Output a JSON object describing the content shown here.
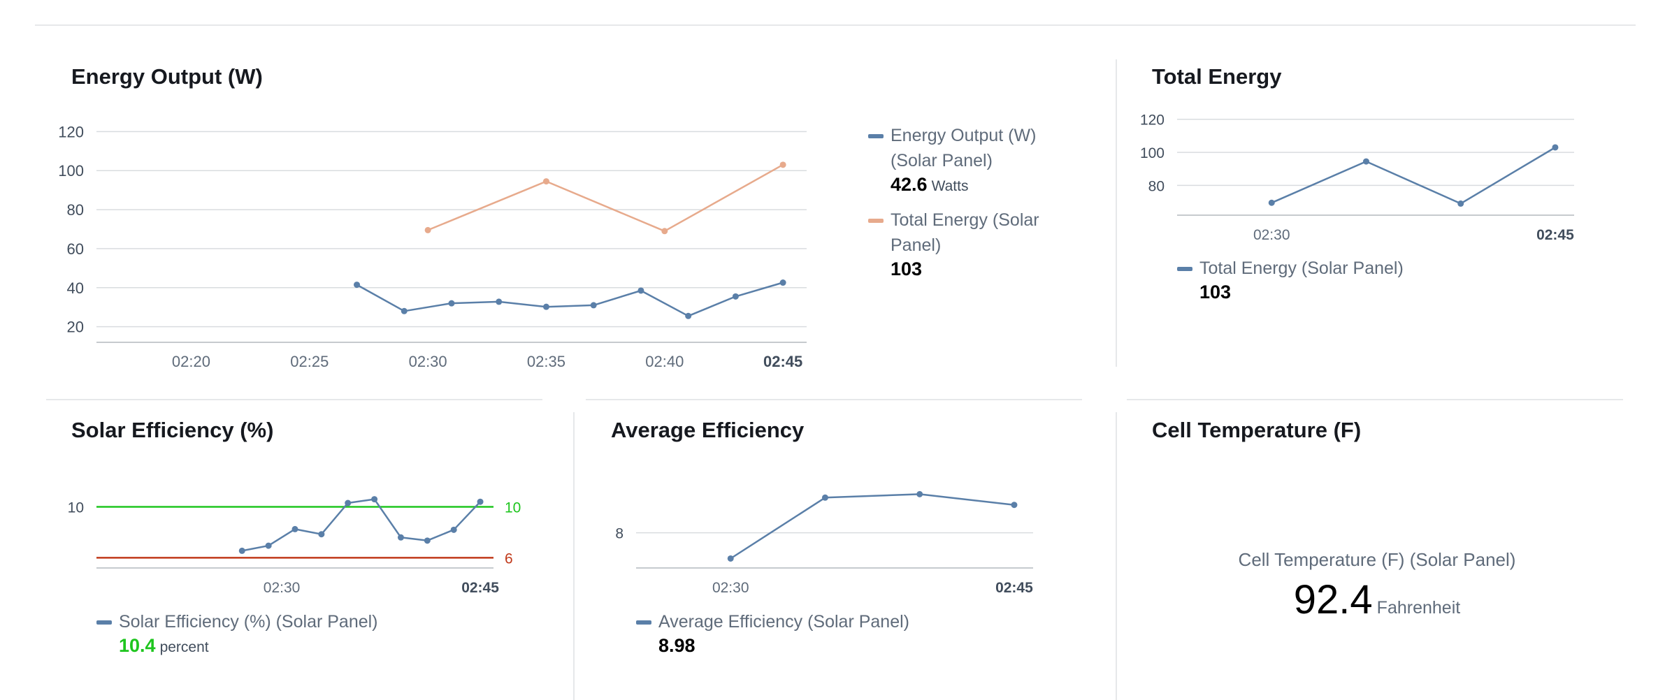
{
  "panels": {
    "energy_output": {
      "title": "Energy Output (W)",
      "legend": [
        {
          "name": "Energy Output (W) (Solar Panel)",
          "value": "42.6",
          "unit": "Watts",
          "color": "#5a7fa8"
        },
        {
          "name": "Total Energy (Solar Panel)",
          "value": "103",
          "unit": "",
          "color": "#e7aa8c"
        }
      ]
    },
    "total_energy": {
      "title": "Total Energy",
      "legend": [
        {
          "name": "Total Energy (Solar Panel)",
          "value": "103",
          "unit": "",
          "color": "#5a7fa8"
        }
      ]
    },
    "solar_efficiency": {
      "title": "Solar Efficiency (%)",
      "legend": [
        {
          "name": "Solar Efficiency (%) (Solar Panel)",
          "value": "10.4",
          "unit": "percent",
          "color": "#5a7fa8",
          "value_color": "#1ec51e"
        }
      ]
    },
    "average_efficiency": {
      "title": "Average Efficiency",
      "legend": [
        {
          "name": "Average Efficiency (Solar Panel)",
          "value": "8.98",
          "unit": "",
          "color": "#5a7fa8"
        }
      ]
    },
    "cell_temperature": {
      "title": "Cell Temperature (F)",
      "kpi_name": "Cell Temperature (F) (Solar Panel)",
      "kpi_value": "92.4",
      "kpi_unit": "Fahrenheit"
    }
  },
  "chart_data": [
    {
      "id": "energy_output",
      "type": "line",
      "title": "Energy Output (W)",
      "x_unit": "minutes",
      "xlim": [
        "02:16",
        "02:46"
      ],
      "ylim": [
        12,
        128
      ],
      "yticks": [
        20,
        40,
        60,
        80,
        100,
        120
      ],
      "xticks": [
        "02:20",
        "02:25",
        "02:30",
        "02:35",
        "02:40",
        "02:45"
      ],
      "xtick_bold": "02:45",
      "grid": true,
      "legend_position": "right",
      "series": [
        {
          "name": "Energy Output (W) (Solar Panel)",
          "color": "#5a7fa8",
          "x": [
            "02:27",
            "02:29",
            "02:31",
            "02:33",
            "02:35",
            "02:37",
            "02:39",
            "02:41",
            "02:43",
            "02:45"
          ],
          "y": [
            41.5,
            28,
            32,
            32.8,
            30.2,
            31,
            38.5,
            25.5,
            35.5,
            42.6
          ]
        },
        {
          "name": "Total Energy (Solar Panel)",
          "color": "#e7aa8c",
          "x": [
            "02:30",
            "02:35",
            "02:40",
            "02:45"
          ],
          "y": [
            69.5,
            94.5,
            69,
            103
          ]
        }
      ]
    },
    {
      "id": "total_energy",
      "type": "line",
      "title": "Total Energy",
      "xlim": [
        "02:25",
        "02:46"
      ],
      "ylim": [
        62,
        122
      ],
      "yticks": [
        80,
        100,
        120
      ],
      "xticks": [
        "02:30",
        "02:45"
      ],
      "xtick_bold": "02:45",
      "grid": true,
      "legend_position": "bottom",
      "series": [
        {
          "name": "Total Energy (Solar Panel)",
          "color": "#5a7fa8",
          "x": [
            "02:30",
            "02:35",
            "02:40",
            "02:45"
          ],
          "y": [
            69.5,
            94.5,
            69,
            103
          ]
        }
      ]
    },
    {
      "id": "solar_efficiency",
      "type": "line",
      "title": "Solar Efficiency (%)",
      "xlim": [
        "02:16",
        "02:46"
      ],
      "ylim": [
        5.2,
        11.4
      ],
      "yticks": [
        10
      ],
      "xticks": [
        "02:30",
        "02:45"
      ],
      "xtick_bold": "02:45",
      "grid": true,
      "legend_position": "bottom",
      "thresholds": [
        {
          "value": 10,
          "label": "10",
          "color": "#1ec51e"
        },
        {
          "value": 6,
          "label": "6",
          "color": "#c0391a"
        }
      ],
      "series": [
        {
          "name": "Solar Efficiency (%) (Solar Panel)",
          "color": "#5a7fa8",
          "x": [
            "02:27",
            "02:29",
            "02:31",
            "02:33",
            "02:35",
            "02:37",
            "02:39",
            "02:41",
            "02:43",
            "02:45"
          ],
          "y": [
            6.55,
            6.95,
            8.25,
            7.85,
            10.3,
            10.6,
            7.6,
            7.35,
            8.2,
            10.4
          ]
        }
      ]
    },
    {
      "id": "average_efficiency",
      "type": "line",
      "title": "Average Efficiency",
      "xlim": [
        "02:25",
        "02:46"
      ],
      "ylim": [
        7.18,
        9.02
      ],
      "yticks": [
        8
      ],
      "xticks": [
        "02:30",
        "02:45"
      ],
      "xtick_bold": "02:45",
      "grid": true,
      "legend_position": "bottom",
      "series": [
        {
          "name": "Average Efficiency (Solar Panel)",
          "color": "#5a7fa8",
          "x": [
            "02:30",
            "02:35",
            "02:40",
            "02:45"
          ],
          "y": [
            7.4,
            8.82,
            8.9,
            8.65
          ]
        }
      ]
    }
  ]
}
